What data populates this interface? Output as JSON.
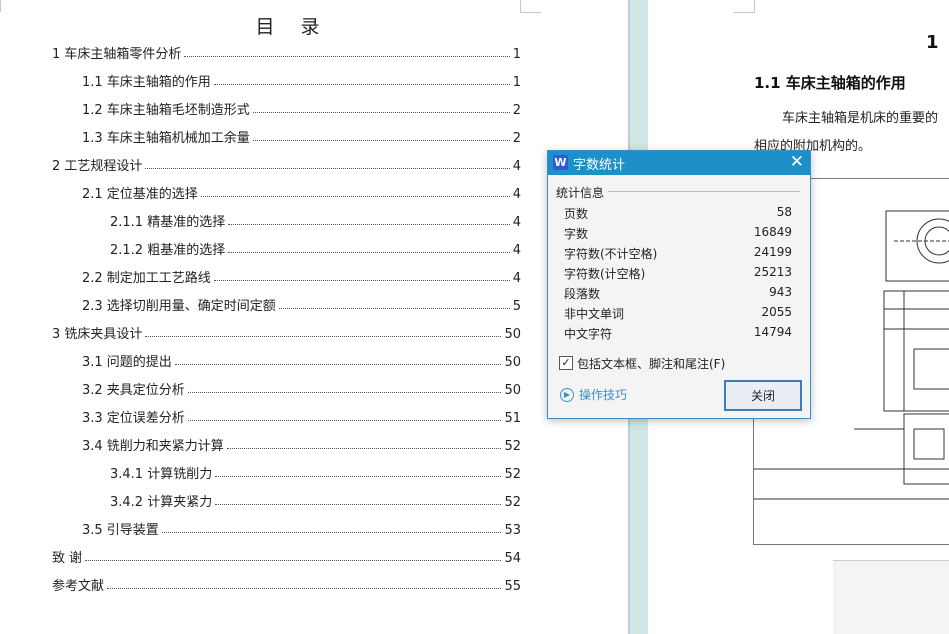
{
  "toc": {
    "title": "目 录",
    "entries": [
      {
        "text": "1 车床主轴箱零件分析",
        "page": "1"
      },
      {
        "text": "1.1 车床主轴箱的作用",
        "page": "1"
      },
      {
        "text": "1.2 车床主轴箱毛坯制造形式",
        "page": "2"
      },
      {
        "text": "1.3 车床主轴箱机械加工余量",
        "page": "2"
      },
      {
        "text": "2 工艺规程设计",
        "page": "4"
      },
      {
        "text": "2.1 定位基准的选择",
        "page": "4"
      },
      {
        "text": "2.1.1 精基准的选择",
        "page": "4"
      },
      {
        "text": "2.1.2 粗基准的选择",
        "page": "4"
      },
      {
        "text": "2.2 制定加工工艺路线",
        "page": "4"
      },
      {
        "text": "2.3 选择切削用量、确定时间定额",
        "page": "5"
      },
      {
        "text": "3 铣床夹具设计",
        "page": "50"
      },
      {
        "text": "3.1 问题的提出",
        "page": "50"
      },
      {
        "text": "3.2 夹具定位分析",
        "page": "50"
      },
      {
        "text": "3.3 定位误差分析",
        "page": "51"
      },
      {
        "text": "3.4 铣削力和夹紧力计算",
        "page": "52"
      },
      {
        "text": "3.4.1 计算铣削力",
        "page": "52"
      },
      {
        "text": "3.4.2 计算夹紧力",
        "page": "52"
      },
      {
        "text": "3.5 引导装置",
        "page": "53"
      },
      {
        "text": "致 谢",
        "page": "54"
      },
      {
        "text": "参考文献",
        "page": "55"
      }
    ]
  },
  "right_page": {
    "chapter_number": "1",
    "section_heading": "1.1 车床主轴箱的作用",
    "paragraph_line1": "车床主轴箱是机床的重要的",
    "paragraph_line2": "相应的附加机构的。"
  },
  "dialog": {
    "app_icon_letter": "W",
    "title": "字数统计",
    "close_glyph": "✕",
    "group_label": "统计信息",
    "stats": [
      {
        "label": "页数",
        "value": "58"
      },
      {
        "label": "字数",
        "value": "16849"
      },
      {
        "label": "字符数(不计空格)",
        "value": "24199"
      },
      {
        "label": "字符数(计空格)",
        "value": "25213"
      },
      {
        "label": "段落数",
        "value": "943"
      },
      {
        "label": "非中文单词",
        "value": "2055"
      },
      {
        "label": "中文字符",
        "value": "14794"
      }
    ],
    "checkbox_label": "包括文本框、脚注和尾注(F)",
    "checkbox_checked": true,
    "tips_label": "操作技巧",
    "close_button_label": "关闭"
  }
}
